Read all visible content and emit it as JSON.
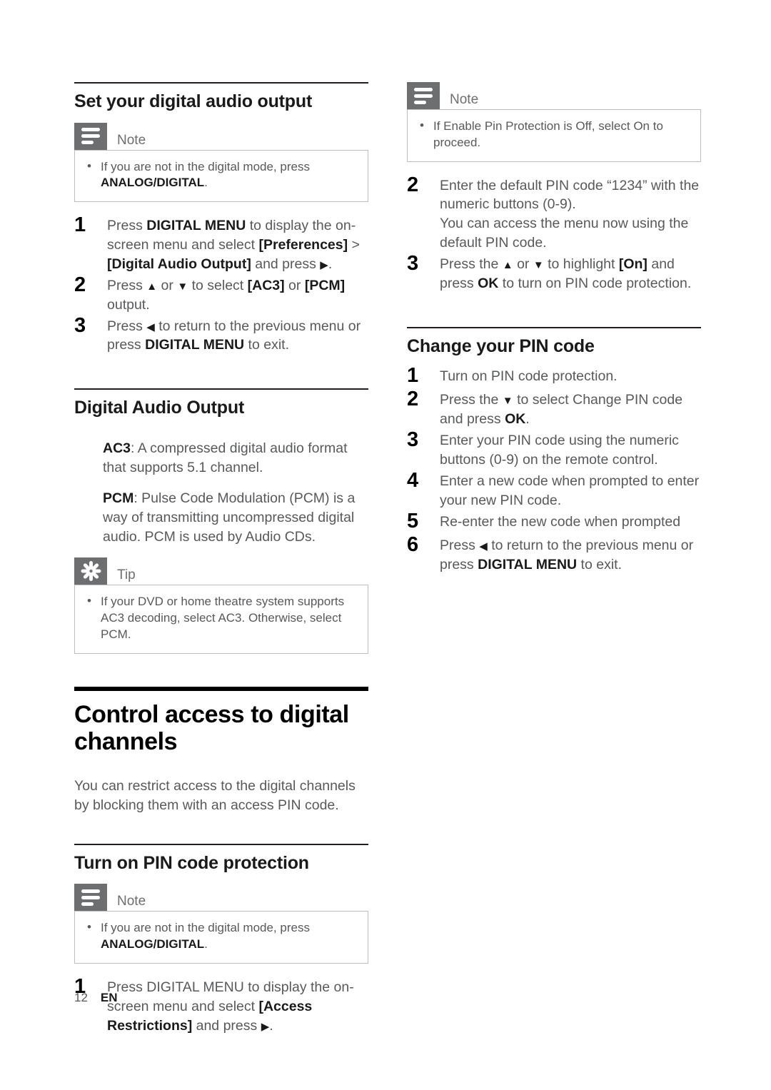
{
  "page": {
    "number": "12",
    "language": "EN"
  },
  "icons": {
    "note": "note-lines-icon",
    "tip": "tip-asterisk-icon"
  },
  "left_column": {
    "section1": {
      "heading": "Set your digital audio output",
      "note": {
        "title": "Note",
        "items": [
          "If you are not in the digital mode, press ANALOG/DIGITAL."
        ],
        "item1_plain": "If you are not in the digital mode, press ",
        "item1_bold": "ANALOG/DIGITAL",
        "item1_tail": "."
      },
      "steps": [
        {
          "num": "1",
          "parts": [
            {
              "t": "Press ",
              "b": false
            },
            {
              "t": "DIGITAL MENU",
              "b": true
            },
            {
              "t": " to display the on-screen menu and select ",
              "b": false
            },
            {
              "t": "[Preferences]",
              "b": true
            },
            {
              "t": " > ",
              "b": false
            },
            {
              "t": "[Digital Audio Output]",
              "b": true
            },
            {
              "t": " and press ",
              "b": false
            },
            {
              "t": "▶",
              "b": false
            },
            {
              "t": ".",
              "b": false
            }
          ]
        },
        {
          "num": "2",
          "parts": [
            {
              "t": "Press ",
              "b": false
            },
            {
              "t": "▲",
              "b": false
            },
            {
              "t": " or ",
              "b": false
            },
            {
              "t": "▼",
              "b": false
            },
            {
              "t": " to select ",
              "b": false
            },
            {
              "t": "[AC3]",
              "b": true
            },
            {
              "t": " or ",
              "b": false
            },
            {
              "t": "[PCM]",
              "b": true
            },
            {
              "t": " output.",
              "b": false
            }
          ]
        },
        {
          "num": "3",
          "parts": [
            {
              "t": "Press ",
              "b": false
            },
            {
              "t": "◀",
              "b": false
            },
            {
              "t": " to return to the previous menu or press ",
              "b": false
            },
            {
              "t": "DIGITAL MENU",
              "b": true
            },
            {
              "t": " to exit.",
              "b": false
            }
          ]
        }
      ]
    },
    "section2": {
      "heading": "Digital Audio Output",
      "definitions": [
        {
          "term": "AC3",
          "text": ": A compressed digital audio format that supports 5.1 channel."
        },
        {
          "term": "PCM",
          "text": ": Pulse Code Modulation (PCM) is a way of transmitting uncompressed digital audio. PCM is used by Audio CDs."
        }
      ],
      "tip": {
        "title": "Tip",
        "items": [
          "If your DVD or home theatre system supports AC3 decoding, select AC3. Otherwise, select PCM."
        ]
      }
    },
    "chapter": {
      "heading": "Control access to digital channels",
      "intro": "You can restrict access to the digital channels by blocking them with an access PIN code."
    },
    "section3": {
      "heading": "Turn on PIN code protection",
      "note": {
        "title": "Note",
        "item1_plain": "If you are not in the digital mode, press ",
        "item1_bold": "ANALOG/DIGITAL",
        "item1_tail": "."
      },
      "steps": [
        {
          "num": "1",
          "parts": [
            {
              "t": "Press DIGITAL MENU to display the on-screen menu and select ",
              "b": false
            },
            {
              "t": "[Access Restrictions]",
              "b": true
            },
            {
              "t": " and press ",
              "b": false
            },
            {
              "t": "▶",
              "b": false
            },
            {
              "t": ".",
              "b": false
            }
          ]
        }
      ]
    }
  },
  "right_column": {
    "note": {
      "title": "Note",
      "items": [
        "If Enable Pin Protection is Off, select On to proceed."
      ]
    },
    "steps_continued": [
      {
        "num": "2",
        "parts": [
          {
            "t": "Enter the default PIN code “1234” with the numeric buttons (0-9).",
            "b": false
          },
          {
            "t": "\n",
            "b": false
          },
          {
            "t": "You can access the menu now using the default PIN code.",
            "b": false
          }
        ]
      },
      {
        "num": "3",
        "parts": [
          {
            "t": "Press the ",
            "b": false
          },
          {
            "t": "▲",
            "b": false
          },
          {
            "t": " or ",
            "b": false
          },
          {
            "t": "▼",
            "b": false
          },
          {
            "t": " to highlight ",
            "b": false
          },
          {
            "t": "[On]",
            "b": true
          },
          {
            "t": " and press ",
            "b": false
          },
          {
            "t": "OK",
            "b": true
          },
          {
            "t": " to turn on PIN code protection.",
            "b": false
          }
        ]
      }
    ],
    "section_change_pin": {
      "heading": "Change your PIN code",
      "steps": [
        {
          "num": "1",
          "parts": [
            {
              "t": "Turn on PIN code protection.",
              "b": false
            }
          ]
        },
        {
          "num": "2",
          "parts": [
            {
              "t": "Press the ",
              "b": false
            },
            {
              "t": "▼",
              "b": false
            },
            {
              "t": " to select Change PIN code and press ",
              "b": false
            },
            {
              "t": "OK",
              "b": true
            },
            {
              "t": ".",
              "b": false
            }
          ]
        },
        {
          "num": "3",
          "parts": [
            {
              "t": "Enter your PIN code using the numeric buttons (0-9) on the remote control.",
              "b": false
            }
          ]
        },
        {
          "num": "4",
          "parts": [
            {
              "t": "Enter a new code when prompted to enter your new PIN code.",
              "b": false
            }
          ]
        },
        {
          "num": "5",
          "parts": [
            {
              "t": "Re-enter the new code when prompted",
              "b": false
            }
          ]
        },
        {
          "num": "6",
          "parts": [
            {
              "t": "Press ",
              "b": false
            },
            {
              "t": "◀",
              "b": false
            },
            {
              "t": " to return to the previous menu or press ",
              "b": false
            },
            {
              "t": "DIGITAL MENU",
              "b": true
            },
            {
              "t": " to exit.",
              "b": false
            }
          ]
        }
      ]
    }
  },
  "colors": {
    "badge_gray": "#6d6e70",
    "body_gray": "#58595b",
    "heading_black": "#1a1a1a",
    "box_border": "#bcbec0"
  }
}
